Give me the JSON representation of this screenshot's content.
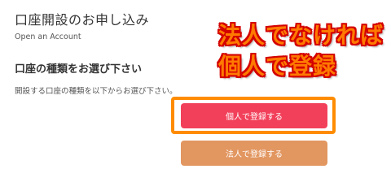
{
  "header": {
    "title": "口座開設のお申し込み",
    "subtitle": "Open an Account"
  },
  "section": {
    "heading": "口座の種類をお選び下さい",
    "description": "開設する口座の種類を以下からお選び下さい。"
  },
  "annotation": {
    "line1": "法人でなければ",
    "line2": "個人で登録",
    "text_color": "#ff7a00",
    "outline_color": "#d40000",
    "frame_color": "#ff8c00"
  },
  "buttons": {
    "individual_label": "個人で登録する",
    "individual_color": "#f2405a",
    "corporate_label": "法人で登録する",
    "corporate_color": "#e29660"
  }
}
